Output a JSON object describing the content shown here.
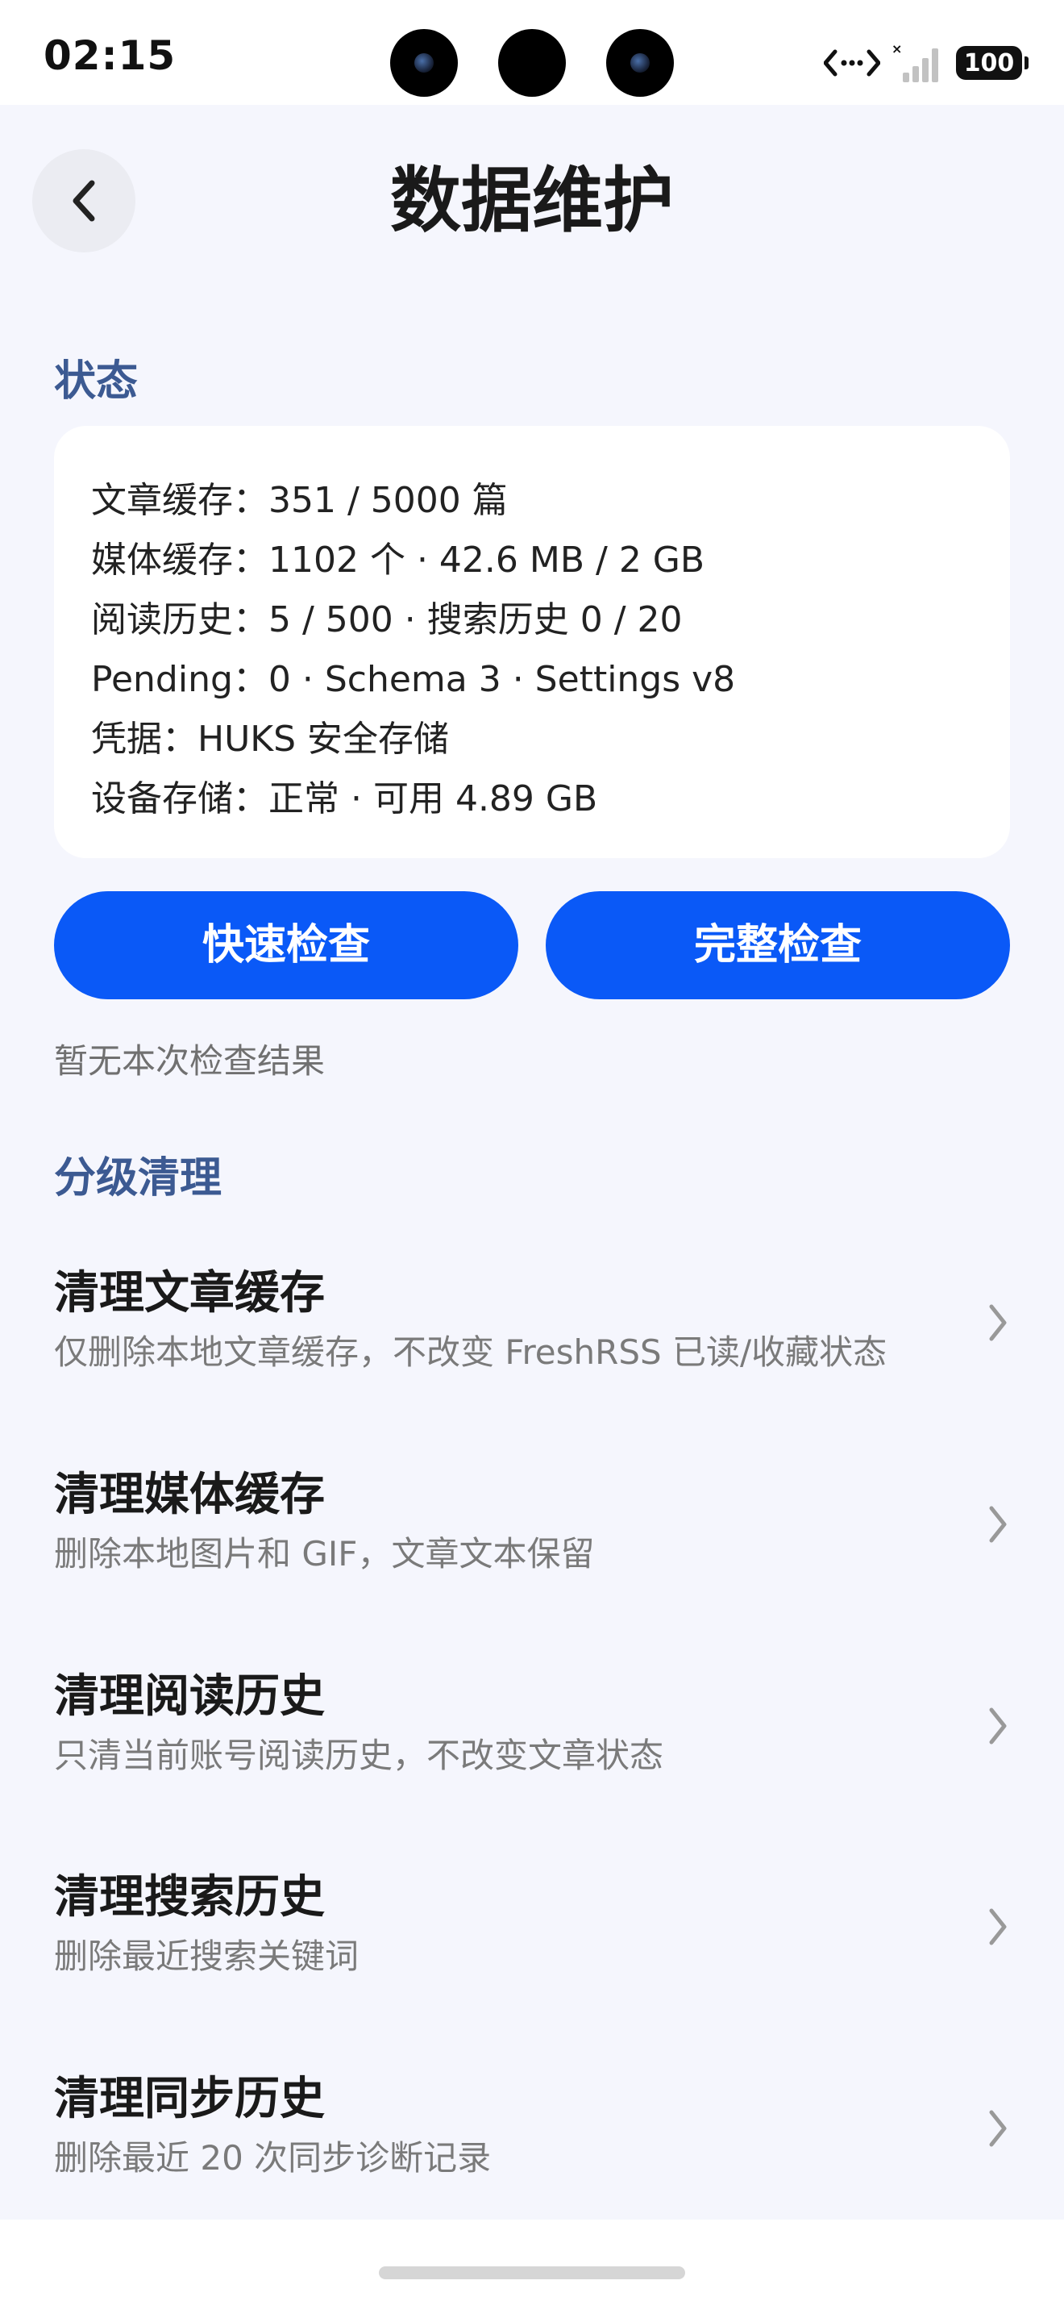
{
  "status_bar": {
    "time": "02:15",
    "battery": "100"
  },
  "header": {
    "title": "数据维护"
  },
  "status_section": {
    "title": "状态",
    "lines": [
      "文章缓存：351 / 5000 篇",
      "媒体缓存：1102 个 · 42.6 MB / 2 GB",
      "阅读历史：5 / 500 · 搜索历史 0 / 20",
      "Pending：0 · Schema 3 · Settings v8",
      "凭据：HUKS 安全存储",
      "设备存储：正常 · 可用 4.89 GB"
    ]
  },
  "actions": {
    "quick_check": "快速检查",
    "full_check": "完整检查",
    "result_text": "暂无本次检查结果"
  },
  "cleanup_section": {
    "title": "分级清理",
    "items": [
      {
        "title": "清理文章缓存",
        "desc": "仅删除本地文章缓存，不改变 FreshRSS 已读/收藏状态"
      },
      {
        "title": "清理媒体缓存",
        "desc": "删除本地图片和 GIF，文章文本保留"
      },
      {
        "title": "清理阅读历史",
        "desc": "只清当前账号阅读历史，不改变文章状态"
      },
      {
        "title": "清理搜索历史",
        "desc": "删除最近搜索关键词"
      },
      {
        "title": "清理同步历史",
        "desc": "删除最近 20 次同步诊断记录"
      }
    ]
  },
  "colors": {
    "accent": "#0a59f7",
    "section_title": "#3c5a92",
    "background": "#f5f6fd"
  },
  "icons": {
    "back": "chevron-left-icon",
    "row": "chevron-right-icon",
    "network": "network-transfer-icon",
    "signal": "cellular-signal-icon"
  }
}
